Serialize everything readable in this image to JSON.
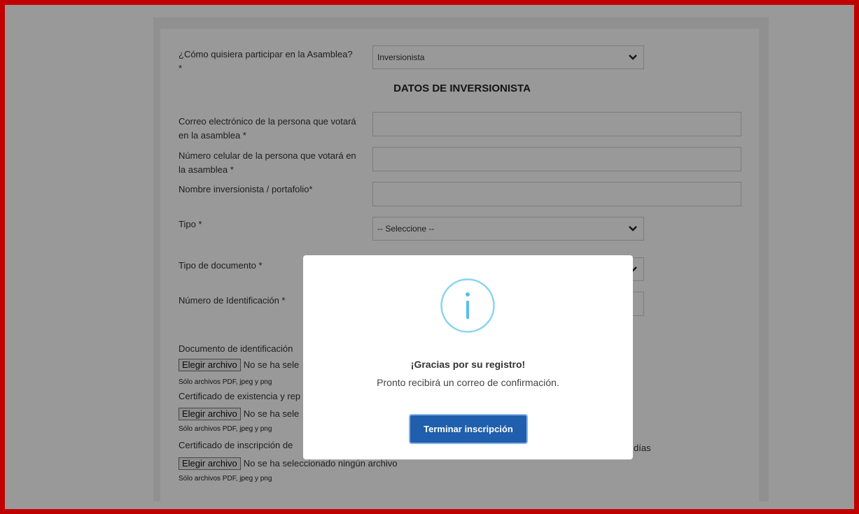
{
  "form": {
    "participation_label": "¿Cómo quisiera participar en la Asamblea? *",
    "participation_value": "Inversionista",
    "section_title": "DATOS DE INVERSIONISTA",
    "email_label": "Correo electrónico de la persona que votará en la asamblea *",
    "phone_label": "Número celular de la persona que votará en la asamblea *",
    "investor_name_label": "Nombre inversionista / portafolio*",
    "type_label": "Tipo *",
    "type_value": "-- Seleccione --",
    "doc_type_label": "Tipo de documento *",
    "id_number_label": "Número de Identificación *",
    "files": [
      {
        "label": "Documento de identificación",
        "button": "Elegir archivo",
        "status": "No se ha sele",
        "hint": "Sólo archivos PDF, jpeg y png"
      },
      {
        "label": "Certificado de existencia y rep",
        "button": "Elegir archivo",
        "status": "No se ha sele",
        "hint": "Sólo archivos PDF, jpeg y png"
      },
      {
        "label": "Certificado de inscripción de",
        "label_tail": "días",
        "button": "Elegir archivo",
        "status": "No se ha seleccionado ningún archivo",
        "hint": "Sólo archivos PDF, jpeg y png"
      }
    ]
  },
  "modal": {
    "icon": "info-icon",
    "title": "¡Gracias por su registro!",
    "message": "Pronto recibirá un correo de confirmación.",
    "button_label": "Terminar inscripción"
  },
  "colors": {
    "frame": "#c00000",
    "primary_button": "#1f5fad",
    "info_icon": "#87d4ef"
  }
}
